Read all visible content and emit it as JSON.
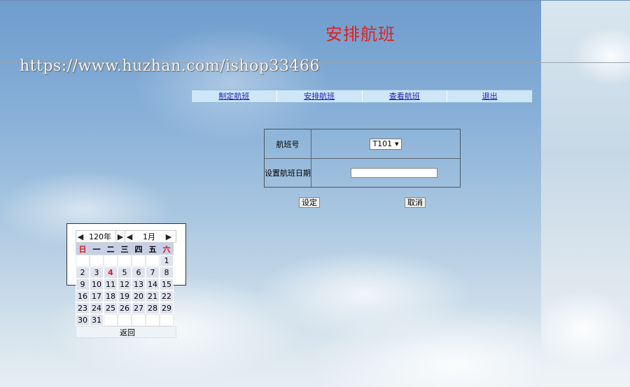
{
  "header": {
    "title": "安排航班",
    "watermark": "https://www.huzhan.com/ishop33466"
  },
  "nav": {
    "items": [
      "制定航班",
      "安排航班",
      "查看航班",
      "退出"
    ]
  },
  "form": {
    "flight_label": "航班号",
    "flight_value": "T101",
    "date_label": "设置航班日期",
    "date_value": ""
  },
  "buttons": {
    "set": "设定",
    "cancel": "取消"
  },
  "calendar": {
    "year": "120年",
    "month": "1月",
    "weekdays": [
      "日",
      "一",
      "二",
      "三",
      "四",
      "五",
      "六"
    ],
    "days": [
      "",
      "",
      "",
      "",
      "",
      "",
      "1",
      "2",
      "3",
      "4",
      "5",
      "6",
      "7",
      "8",
      "9",
      "10",
      "11",
      "12",
      "13",
      "14",
      "15",
      "16",
      "17",
      "18",
      "19",
      "20",
      "21",
      "22",
      "23",
      "24",
      "25",
      "26",
      "27",
      "28",
      "29",
      "30",
      "31",
      "",
      "",
      "",
      "",
      ""
    ],
    "today": "4",
    "return_label": "返回"
  },
  "icons": {
    "arrow_left": "triangle-left-icon",
    "arrow_right": "triangle-right-icon",
    "dropdown": "triangle-down-icon"
  },
  "colors": {
    "title": "#e02020",
    "link": "#1a1ab8",
    "navbar": "#cde6f8",
    "weekday_header": "#c8d0e6",
    "day_cell": "#dfe3ef"
  }
}
